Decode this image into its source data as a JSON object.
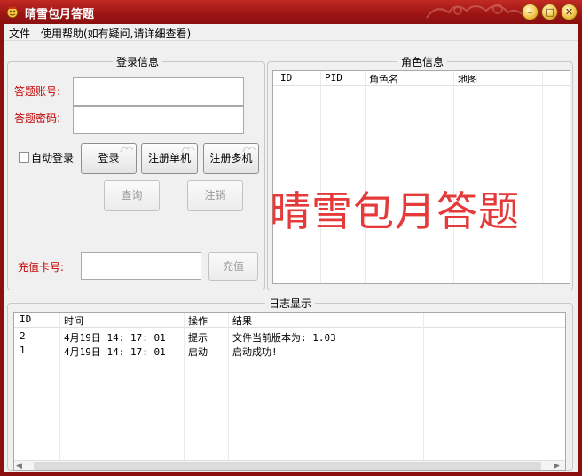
{
  "window": {
    "title": "晴雪包月答题"
  },
  "menu": [
    {
      "label": "文件"
    },
    {
      "label": "使用帮助(如有疑问,请详细查看)"
    }
  ],
  "login": {
    "group_title": "登录信息",
    "account_label": "答题账号:",
    "password_label": "答题密码:",
    "account_value": "",
    "password_value": "",
    "auto_login_label": "自动登录",
    "auto_login_checked": false,
    "buttons": {
      "login": "登录",
      "register_single": "注册单机",
      "register_multi": "注册多机",
      "query": "查询",
      "logout": "注销"
    },
    "recharge_label": "充值卡号:",
    "recharge_value": "",
    "recharge_button": "充值"
  },
  "role": {
    "group_title": "角色信息",
    "columns": [
      "ID",
      "PID",
      "角色名",
      "地图"
    ],
    "watermark": "晴雪包月答题"
  },
  "log": {
    "group_title": "日志显示",
    "columns": [
      "ID",
      "时间",
      "操作",
      "结果"
    ],
    "rows": [
      {
        "id": "2",
        "time": "4月19日  14: 17: 01",
        "action": "提示",
        "result": "文件当前版本为: 1.03"
      },
      {
        "id": "1",
        "time": "4月19日  14: 17: 01",
        "action": "启动",
        "result": "启动成功!"
      }
    ]
  },
  "colors": {
    "title_bar": "#9c1414",
    "label_red": "#c40000",
    "watermark": "#e53a3a",
    "window_border": "#8a1010"
  }
}
